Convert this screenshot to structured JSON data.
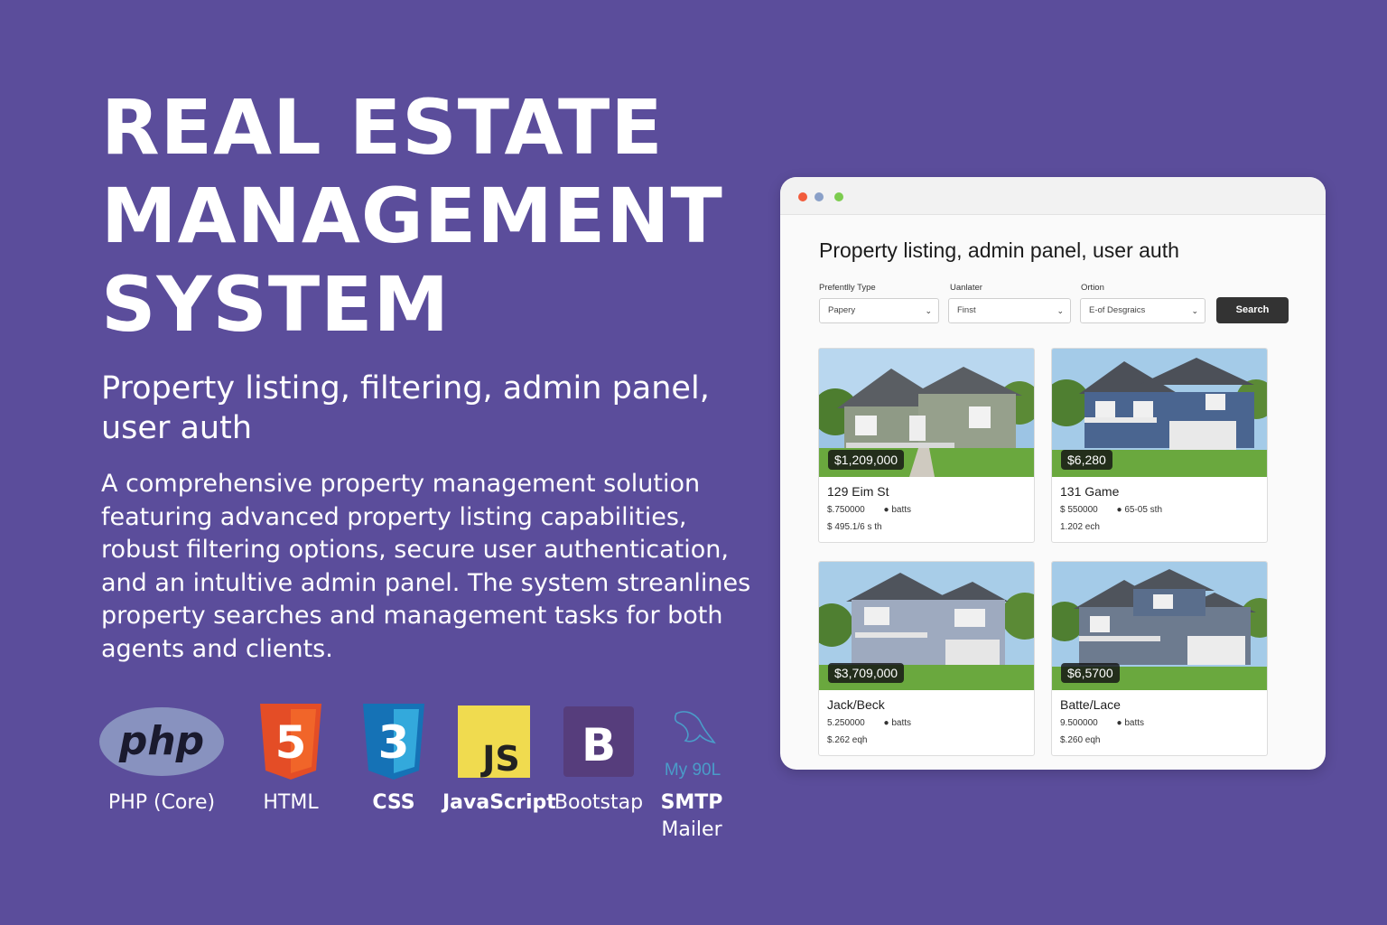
{
  "hero": {
    "title_lines": [
      "REAL ESTATE",
      "MANAGEMENT",
      "SYSTEM"
    ],
    "subtitle": "Property listing, filtering, admin panel, user auth",
    "description": "A comprehensive property management solution featuring advanced property listing capabilities, robust filtering options, secure user authentication, and an intultive admin panel. The system streanlines property searches and management tasks for both agents and clients."
  },
  "tech_stack": [
    {
      "label": "PHP (Core)",
      "icon": "php-logo-icon",
      "logo_text": "php"
    },
    {
      "label": "HTML",
      "icon": "html5-logo-icon",
      "logo_text": "5"
    },
    {
      "label": "CSS",
      "icon": "css3-logo-icon",
      "logo_text": "3"
    },
    {
      "label": "JavaScript",
      "icon": "js-logo-icon",
      "logo_text": "JS"
    },
    {
      "label": "Bootstap",
      "icon": "bootstrap-logo-icon",
      "logo_text": "B"
    },
    {
      "label_line1": "SMTP",
      "label_line2": "Mailer",
      "icon": "mysql-dolphin-icon",
      "logo_text": "My 90L"
    }
  ],
  "app": {
    "window_title": "Property listing, admin panel, user auth",
    "filters": [
      {
        "label": "Prefentlly Type",
        "value": "Papery"
      },
      {
        "label": "Uanlater",
        "value": "Finst"
      },
      {
        "label": "Ortion",
        "value": "E-of Desgraics"
      }
    ],
    "search_label": "Search",
    "listings": [
      {
        "price": "$1,209,000",
        "name": "129 Eim St",
        "a": "$.750000",
        "b": "batts",
        "c": "$ 495.1/6 s th"
      },
      {
        "price": "$6,280",
        "name": "131 Game",
        "a": "$ 550000",
        "b": "65-05 sth",
        "c": "1.202 ech"
      },
      {
        "price": "$3,709,000",
        "name": "Jack/Beck",
        "a": "5.250000",
        "b": "batts",
        "c": "$.262 eqh"
      },
      {
        "price": "$6,5700",
        "name": "Batte/Lace",
        "a": "9.500000",
        "b": "batts",
        "c": "$.260 eqh"
      }
    ]
  },
  "colors": {
    "background": "#5b4d9b",
    "window_dot_red": "#f25c3c",
    "window_dot_blue": "#8aa0c8",
    "window_dot_green": "#7ccc4f",
    "search_button": "#333333"
  }
}
